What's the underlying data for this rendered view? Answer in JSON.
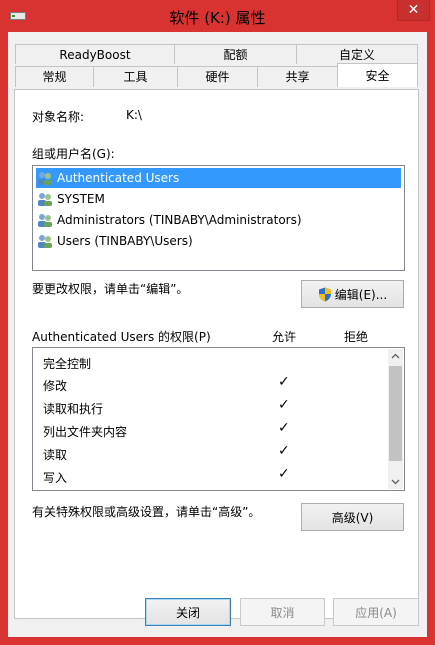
{
  "window": {
    "title": "软件 (K:) 属性",
    "close_glyph": "✕"
  },
  "tabs_row1": [
    {
      "label": "ReadyBoost"
    },
    {
      "label": "配额"
    },
    {
      "label": "自定义"
    }
  ],
  "tabs_row2": [
    {
      "label": "常规"
    },
    {
      "label": "工具"
    },
    {
      "label": "硬件"
    },
    {
      "label": "共享"
    },
    {
      "label": "安全"
    }
  ],
  "security": {
    "object_label": "对象名称:",
    "object_value": "K:\\",
    "group_label": "组或用户名(G):",
    "users": [
      {
        "name": "Authenticated Users"
      },
      {
        "name": "SYSTEM"
      },
      {
        "name": "Administrators (TINBABY\\Administrators)"
      },
      {
        "name": "Users (TINBABY\\Users)"
      }
    ],
    "change_text": "要更改权限，请单击“编辑”。",
    "edit_button": "编辑(E)...",
    "perm_header": "Authenticated Users 的权限(P)",
    "allow_header": "允许",
    "deny_header": "拒绝",
    "permissions": [
      {
        "name": "完全控制",
        "allow": ""
      },
      {
        "name": "修改",
        "allow": "✓"
      },
      {
        "name": "读取和执行",
        "allow": "✓"
      },
      {
        "name": "列出文件夹内容",
        "allow": "✓"
      },
      {
        "name": "读取",
        "allow": "✓"
      },
      {
        "name": "写入",
        "allow": "✓"
      }
    ],
    "advanced_text": "有关特殊权限或高级设置，请单击“高级”。",
    "advanced_button": "高级(V)"
  },
  "footer": {
    "close": "关闭",
    "cancel": "取消",
    "apply": "应用(A)"
  }
}
